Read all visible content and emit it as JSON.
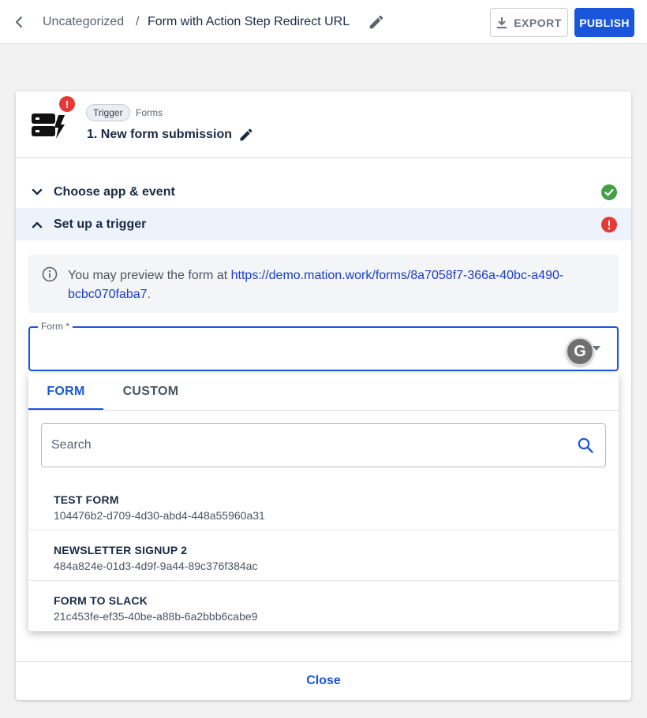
{
  "header": {
    "breadcrumb_parent": "Uncategorized",
    "breadcrumb_separator": "/",
    "title": "Form with Action Step Redirect URL",
    "export_label": "EXPORT",
    "publish_label": "PUBLISH"
  },
  "step": {
    "chip_label": "Trigger",
    "app_name": "Forms",
    "title": "1. New form submission",
    "alert_badge": "!"
  },
  "sections": [
    {
      "label": "Choose app & event",
      "status": "complete"
    },
    {
      "label": "Set up a trigger",
      "status": "error"
    }
  ],
  "info": {
    "text": "You may preview the form at ",
    "link": "https://demo.mation.work/forms/8a7058f7-366a-40bc-a490-bcbc070faba7",
    "suffix": "."
  },
  "form_field": {
    "label": "Form *",
    "value": ""
  },
  "dropdown": {
    "tabs": [
      "FORM",
      "CUSTOM"
    ],
    "active_tab": "FORM",
    "search_placeholder": "Search",
    "items": [
      {
        "name": "TEST FORM",
        "id": "104476b2-d709-4d30-abd4-448a55960a31"
      },
      {
        "name": "NEWSLETTER SIGNUP 2",
        "id": "484a824e-01d3-4d9f-9a44-89c376f384ac"
      },
      {
        "name": "FORM TO SLACK",
        "id": "21c453fe-ef35-40be-a88b-6a2bbb6cabe9"
      }
    ]
  },
  "footer": {
    "close_label": "Close"
  },
  "colors": {
    "primary": "#1a56db",
    "success": "#43a047",
    "error": "#e53935",
    "text_dark": "#1b2a44"
  },
  "icons": {
    "back": "arrow-left-icon",
    "edit": "pencil-icon",
    "export": "download-icon",
    "app": "forms-app-icon",
    "info": "info-circle-icon",
    "search": "search-icon",
    "grammarly": "grammarly-icon"
  }
}
